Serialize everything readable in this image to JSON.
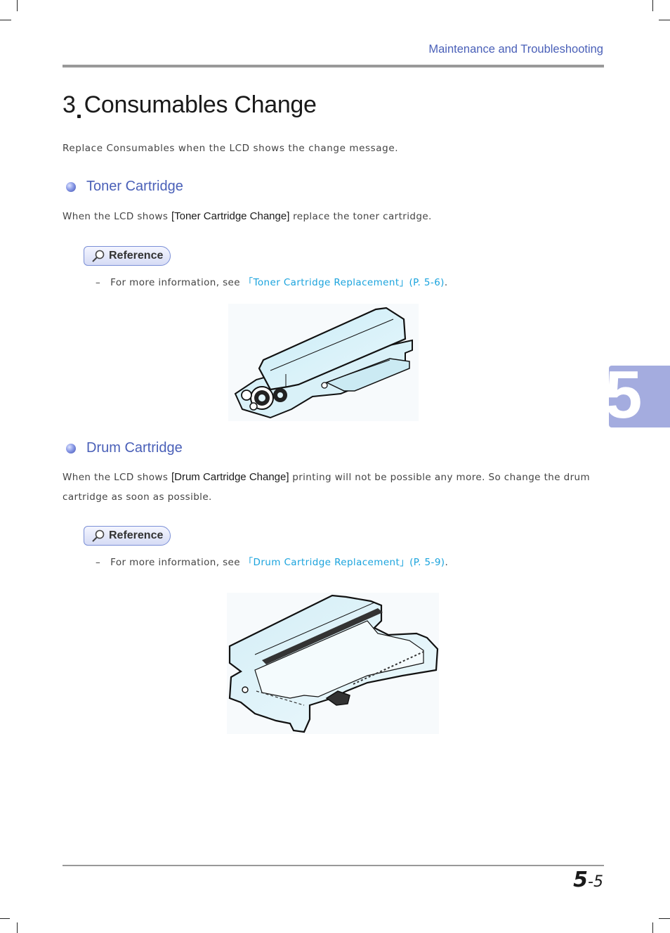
{
  "header": {
    "section_title": "Maintenance and Troubleshooting"
  },
  "page": {
    "title_number": "3",
    "title_text": "Consumables Change",
    "intro": "Replace Consumables when the LCD shows the change message."
  },
  "sections": [
    {
      "heading": "Toner Cartridge",
      "text_before": "When the LCD shows ",
      "lcd_message": "[Toner Cartridge Change]",
      "text_after": " replace the toner cartridge.",
      "reference": {
        "badge_label": "Reference",
        "dash": "–",
        "prefix": "For more information, see ",
        "link_text": "「Toner Cartridge Replacement」(P. 5-6)",
        "suffix": "."
      },
      "illustration": "toner-cartridge-illustration"
    },
    {
      "heading": "Drum Cartridge",
      "text_before": "When the LCD shows ",
      "lcd_message": "[Drum Cartridge Change]",
      "text_after": " printing will not be possible any more. So change the drum cartridge as soon as possible.",
      "reference": {
        "badge_label": "Reference",
        "dash": "–",
        "prefix": "For more information, see ",
        "link_text": "「Drum Cartridge Replacement」(P. 5-9)",
        "suffix": "."
      },
      "illustration": "drum-cartridge-illustration"
    }
  ],
  "chapter_tab": {
    "number": "5"
  },
  "footer": {
    "chapter": "5",
    "separator": "-",
    "page": "5"
  },
  "colors": {
    "accent": "#4a60b8",
    "link": "#1aa3dd",
    "tab": "#a4acdf",
    "rule": "#999999"
  }
}
